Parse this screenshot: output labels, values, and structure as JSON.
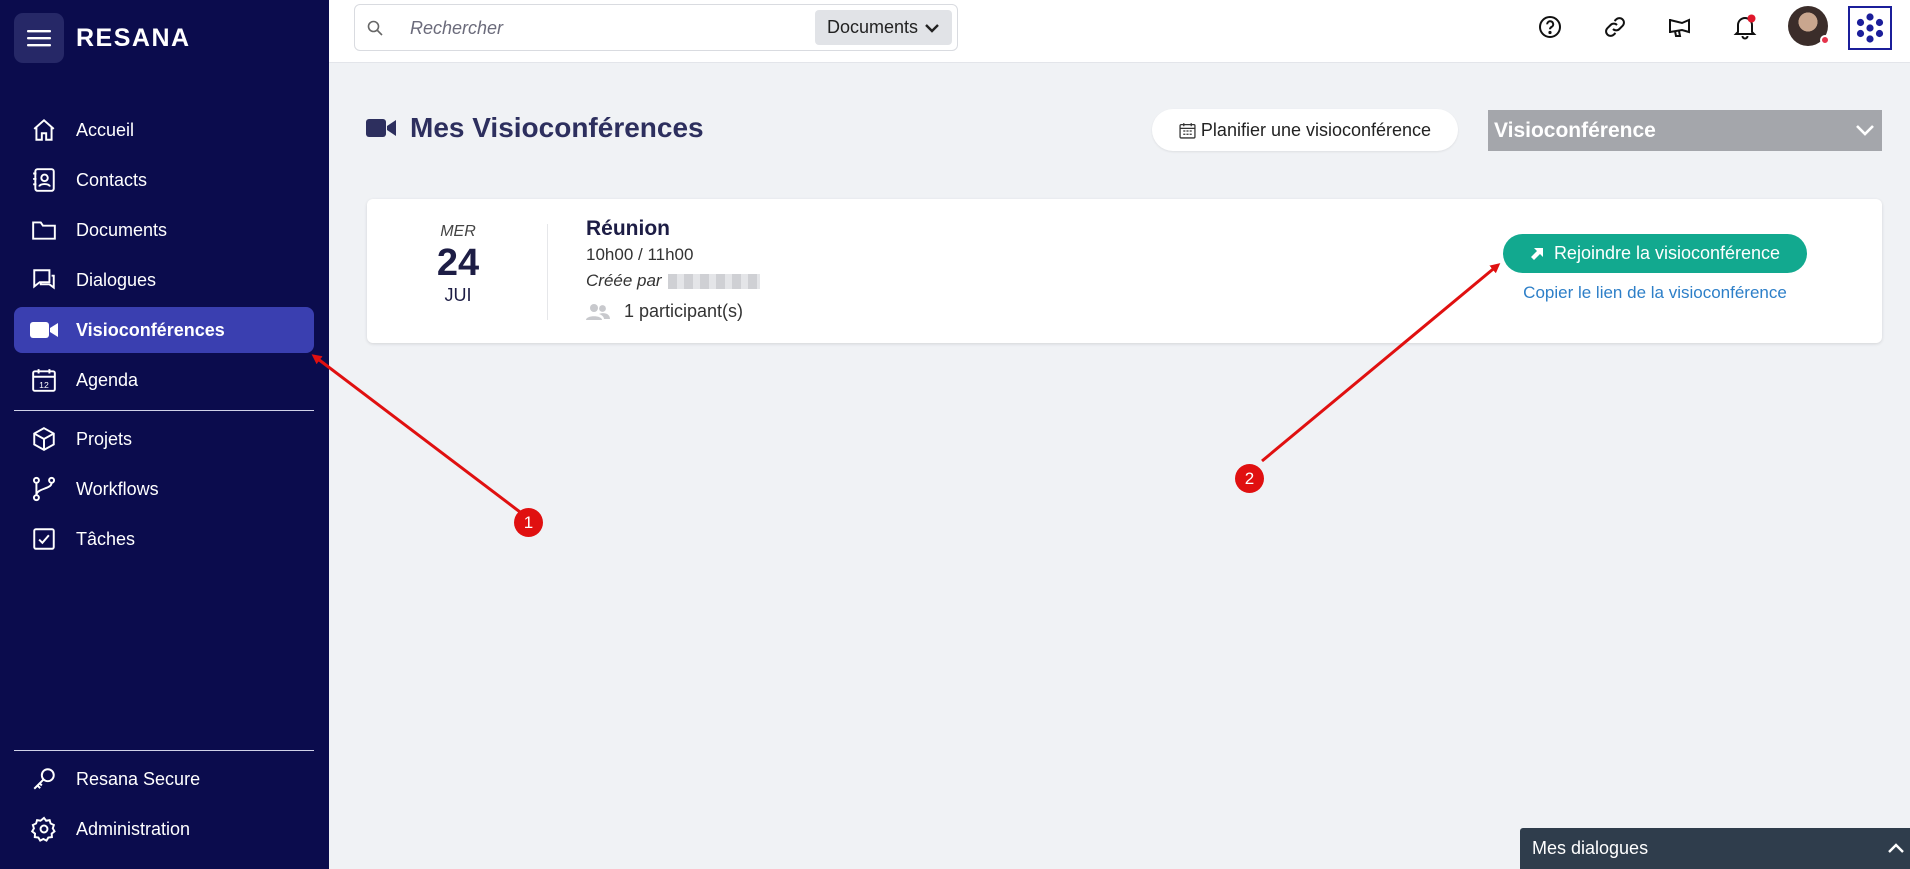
{
  "sidebar": {
    "brand": "RESANA",
    "items": [
      {
        "label": "Accueil",
        "icon": "home-icon"
      },
      {
        "label": "Contacts",
        "icon": "contacts-icon"
      },
      {
        "label": "Documents",
        "icon": "folder-icon"
      },
      {
        "label": "Dialogues",
        "icon": "dialogues-icon"
      },
      {
        "label": "Visioconférences",
        "icon": "video-icon",
        "active": true
      },
      {
        "label": "Agenda",
        "icon": "calendar-icon"
      }
    ],
    "items2": [
      {
        "label": "Projets",
        "icon": "cube-icon"
      },
      {
        "label": "Workflows",
        "icon": "workflow-icon"
      },
      {
        "label": "Tâches",
        "icon": "task-check-icon"
      }
    ],
    "bottom": [
      {
        "label": "Resana Secure",
        "icon": "key-icon"
      },
      {
        "label": "Administration",
        "icon": "gear-icon"
      }
    ]
  },
  "topbar": {
    "search_placeholder": "Rechercher",
    "search_scope": "Documents"
  },
  "main": {
    "title": "Mes Visioconférences",
    "plan_button": "Planifier une visioconférence",
    "filter_value": "Visioconférence"
  },
  "meeting": {
    "dow": "MER",
    "day": "24",
    "month": "JUI",
    "title": "Réunion",
    "time": "10h00 / 11h00",
    "created_by": "Créée par",
    "participants": "1 participant(s)",
    "join_label": "Rejoindre la visioconférence",
    "copy_label": "Copier le lien de la visioconférence"
  },
  "dialogs_panel": "Mes dialogues",
  "annotations": {
    "badge1": "1",
    "badge2": "2"
  },
  "colors": {
    "sidebar_bg": "#0b0c4d",
    "active_item": "#3a3fb0",
    "join_button": "#12a98f",
    "link": "#2d7fc8",
    "annotation": "#e01010"
  }
}
